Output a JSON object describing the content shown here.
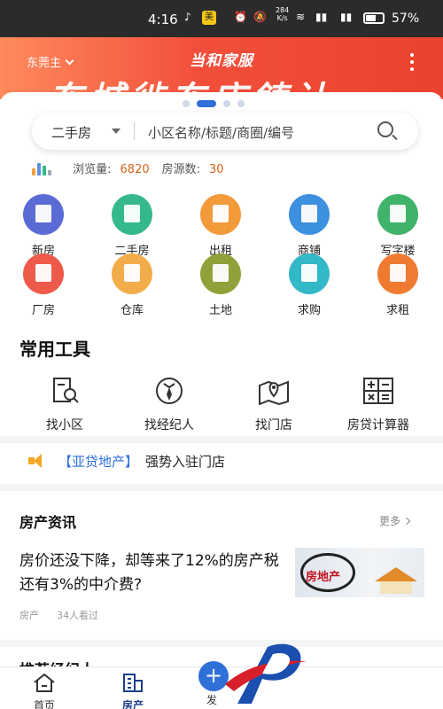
{
  "status_bar": {
    "time": "4:16",
    "app_badge": "美",
    "net_speed": "284",
    "net_unit": "K/s",
    "battery": "57%"
  },
  "header": {
    "city": "东莞主",
    "brand": "当和家服",
    "slogan": "东城徙东店鋳计"
  },
  "search": {
    "type": "二手房",
    "placeholder": "小区名称/标题/商圈/编号"
  },
  "stats": {
    "views_label": "浏览量:",
    "views": "6820",
    "listings_label": "房源数:",
    "listings": "30"
  },
  "categories": [
    {
      "label": "新房",
      "icon": "building-icon",
      "color": "#5b6bd6"
    },
    {
      "label": "二手房",
      "icon": "house-icon",
      "color": "#35b98a"
    },
    {
      "label": "出租",
      "icon": "rent-icon",
      "color": "#f39a3a"
    },
    {
      "label": "商铺",
      "icon": "shop-icon",
      "color": "#3d8fe0"
    },
    {
      "label": "写字楼",
      "icon": "office-icon",
      "color": "#3fb36a"
    },
    {
      "label": "厂房",
      "icon": "factory-icon",
      "color": "#ee5a4a"
    },
    {
      "label": "仓库",
      "icon": "warehouse-icon",
      "color": "#f2ad4a"
    },
    {
      "label": "土地",
      "icon": "land-icon",
      "color": "#8fa23a"
    },
    {
      "label": "求购",
      "icon": "buy-request-icon",
      "color": "#33b8c8"
    },
    {
      "label": "求租",
      "icon": "rent-request-icon",
      "color": "#ef7b33"
    }
  ],
  "tools": {
    "title": "常用工具",
    "items": [
      {
        "label": "找小区",
        "icon": "find-community-icon"
      },
      {
        "label": "找经纪人",
        "icon": "agent-icon"
      },
      {
        "label": "找门店",
        "icon": "store-map-icon"
      },
      {
        "label": "房贷计算器",
        "icon": "calculator-icon"
      }
    ]
  },
  "notice": {
    "brand": "【亚贷地产】",
    "message": "强势入驻门店"
  },
  "news": {
    "title": "房产资讯",
    "more": "更多",
    "headline": "房价还没下降，却等来了12%的房产税还有3%的中介费?",
    "category": "房产",
    "views": "34人看过",
    "thumb_text": "房地产"
  },
  "recommend": {
    "title": "推荐经纪人"
  },
  "tabbar": {
    "home": "首页",
    "property": "房产",
    "publish": "发"
  },
  "colors": {
    "accent": "#2f6fd8",
    "banner": "#f24f3b",
    "number": "#d4621c"
  }
}
